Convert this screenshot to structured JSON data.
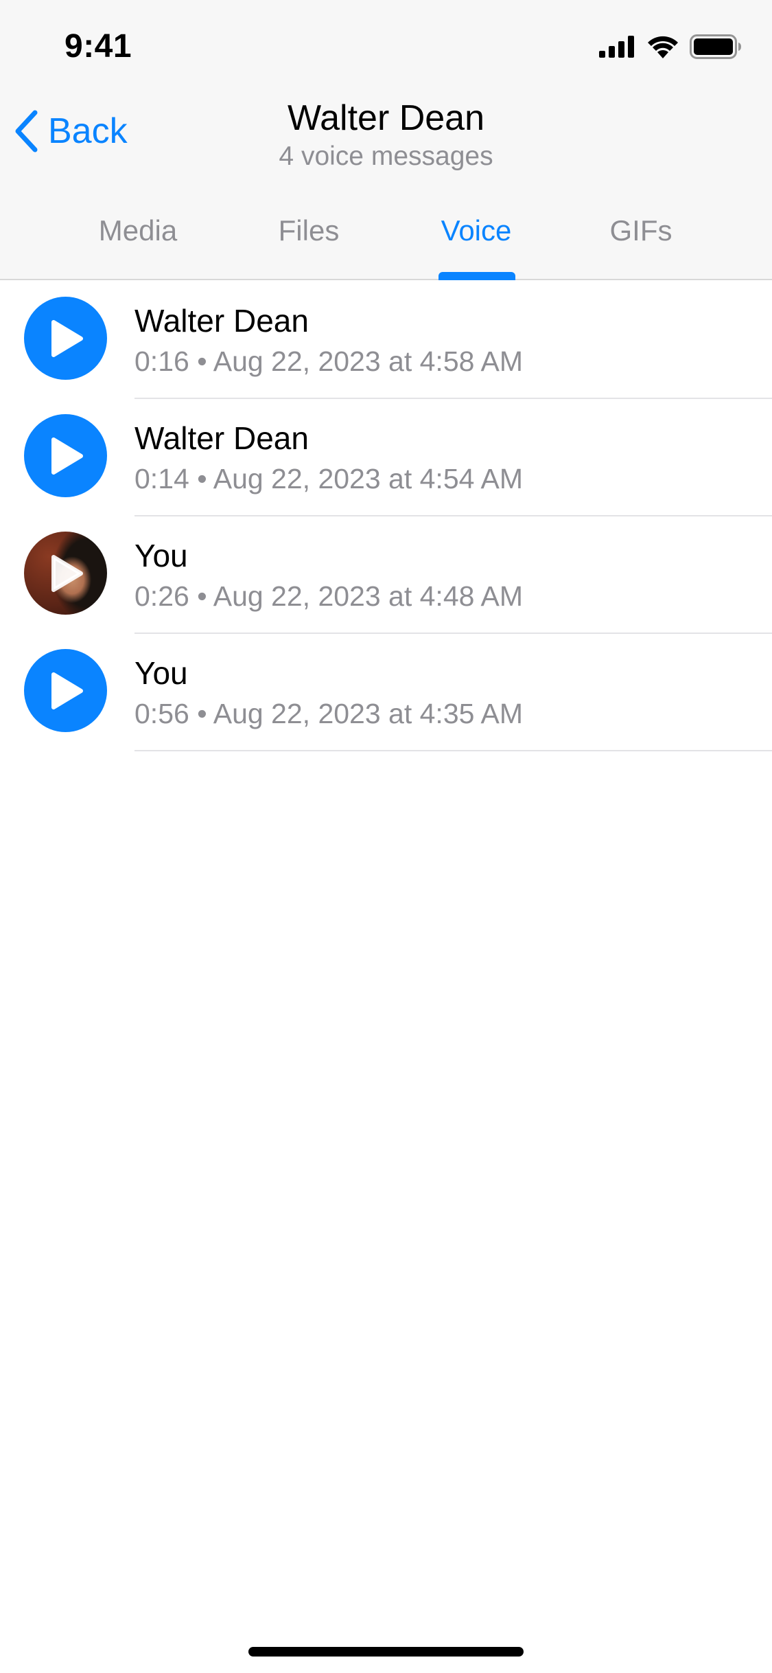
{
  "status_bar": {
    "time": "9:41",
    "icons": [
      "cellular-signal-icon",
      "wifi-icon",
      "battery-icon"
    ]
  },
  "nav": {
    "back_label": "Back",
    "title": "Walter Dean",
    "subtitle": "4 voice messages"
  },
  "tabs": [
    {
      "label": "Media",
      "active": false
    },
    {
      "label": "Files",
      "active": false
    },
    {
      "label": "Voice",
      "active": true
    },
    {
      "label": "GIFs",
      "active": false
    }
  ],
  "messages": [
    {
      "sender": "Walter Dean",
      "duration": "0:16",
      "date": "Aug 22, 2023 at 4:58 AM",
      "avatar": "play-icon"
    },
    {
      "sender": "Walter Dean",
      "duration": "0:14",
      "date": "Aug 22, 2023 at 4:54 AM",
      "avatar": "play-icon"
    },
    {
      "sender": "You",
      "duration": "0:26",
      "date": "Aug 22, 2023 at 4:48 AM",
      "avatar": "user-photo-with-play-icon"
    },
    {
      "sender": "You",
      "duration": "0:56",
      "date": "Aug 22, 2023 at 4:35 AM",
      "avatar": "play-icon"
    }
  ],
  "meta_separator": "•",
  "colors": {
    "accent": "#0a84ff",
    "secondary_text": "#8e8e93",
    "header_bg": "#f7f7f7"
  }
}
